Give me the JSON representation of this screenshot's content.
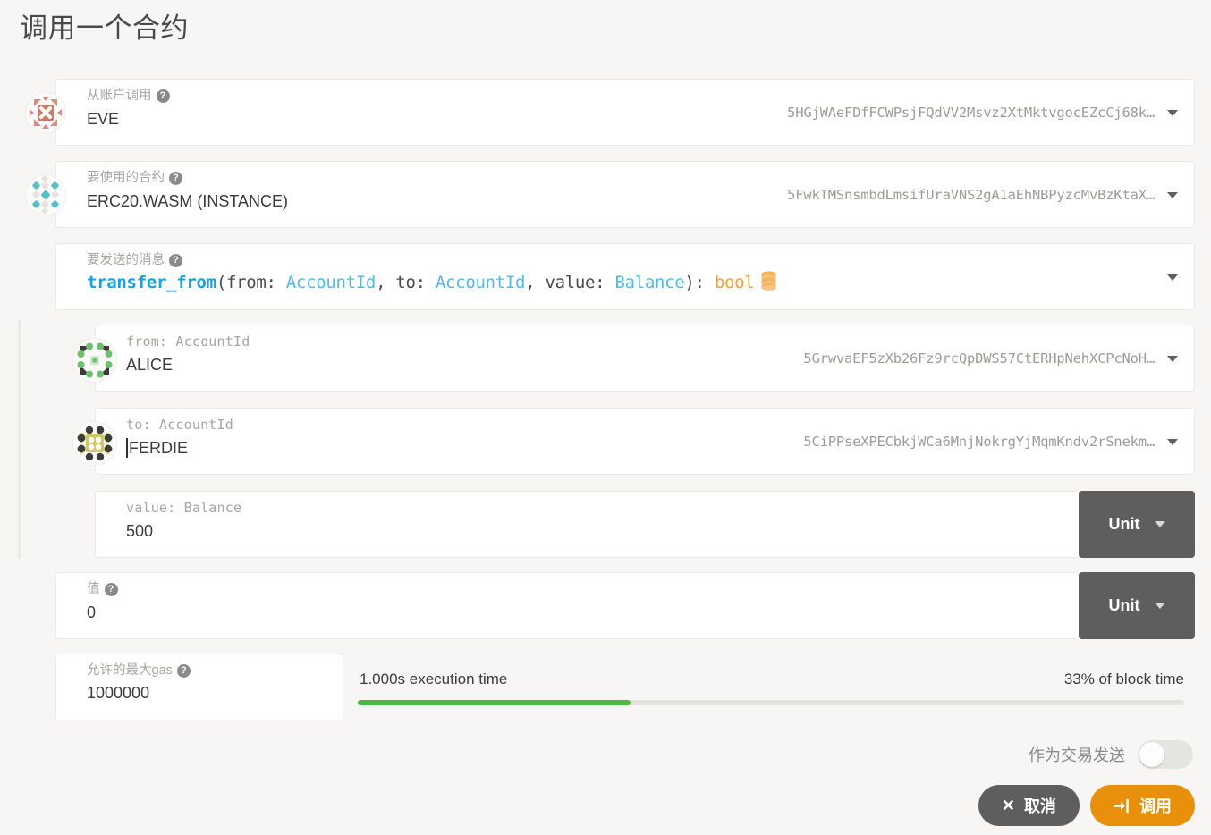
{
  "page": {
    "title": "调用一个合约",
    "background": "#f7f6f4"
  },
  "colors": {
    "accent_orange": "#e8900c",
    "cancel_gray": "#5e5e5e",
    "progress_green": "#4cb849",
    "type_blue": "#55b9e6",
    "fn_blue": "#1ba0e0",
    "return_orange": "#f0a03c",
    "label_gray": "#a8a6a3"
  },
  "fields": {
    "call_from_account": {
      "label": "从账户调用",
      "help": "?",
      "value": "EVE",
      "address": "5HGjWAeFDfFCWPsjFQdVV2Msvz2XtMktvgocEZcCj68k…",
      "icon": "identicon-eve",
      "caret": "chevron-down-icon"
    },
    "contract_to_use": {
      "label": "要使用的合约",
      "help": "?",
      "value": "ERC20.WASM (INSTANCE)",
      "address": "5FwkTMSnsmbdLmsifUraVNS2gA1aEhNBPyzcMvBzKtaX…",
      "icon": "identicon-contract",
      "caret": "chevron-down-icon"
    },
    "message_to_send": {
      "label": "要发送的消息",
      "help": "?",
      "signature": {
        "fn": "transfer_from",
        "open": "(",
        "params": [
          {
            "name": "from: ",
            "type": "AccountId",
            "sep": ", "
          },
          {
            "name": "to: ",
            "type": "AccountId",
            "sep": ", "
          },
          {
            "name": "value: ",
            "type": "Balance",
            "sep": ""
          }
        ],
        "close": "): ",
        "return_type": "bool",
        "return_icon": "database-stack-icon",
        "full_text": "transfer_from(from: AccountId, to: AccountId, value: Balance): bool"
      },
      "caret": "chevron-down-icon"
    },
    "arg_from": {
      "label": "from: AccountId",
      "value": "ALICE",
      "address": "5GrwvaEF5zXb26Fz9rcQpDWS57CtERHpNehXCPcNoH…",
      "icon": "identicon-alice",
      "caret": "chevron-down-icon"
    },
    "arg_to": {
      "label": "to: AccountId",
      "value": "FERDIE",
      "cursor": true,
      "address": "5CiPPseXPECbkjWCa6MnjNokrgYjMqmKndv2rSnekm…",
      "icon": "identicon-ferdie",
      "caret": "chevron-down-icon"
    },
    "arg_value": {
      "label": "value: Balance",
      "value": "500",
      "unit_label": "Unit",
      "unit_caret": "chevron-down-icon"
    },
    "tx_value": {
      "label": "值",
      "help": "?",
      "value": "0",
      "unit_label": "Unit",
      "unit_caret": "chevron-down-icon"
    },
    "max_gas": {
      "label": "允许的最大gas",
      "help": "?",
      "value": "1000000"
    }
  },
  "execution": {
    "time_text": "1.000s execution time",
    "block_text": "33% of block time",
    "percent": 33
  },
  "send_as_transaction": {
    "label": "作为交易发送",
    "enabled": false
  },
  "actions": {
    "cancel": {
      "label": "取消",
      "icon": "close-icon",
      "glyph": "✕"
    },
    "call": {
      "label": "调用",
      "icon": "sign-in-icon",
      "glyph": "⇥"
    }
  }
}
